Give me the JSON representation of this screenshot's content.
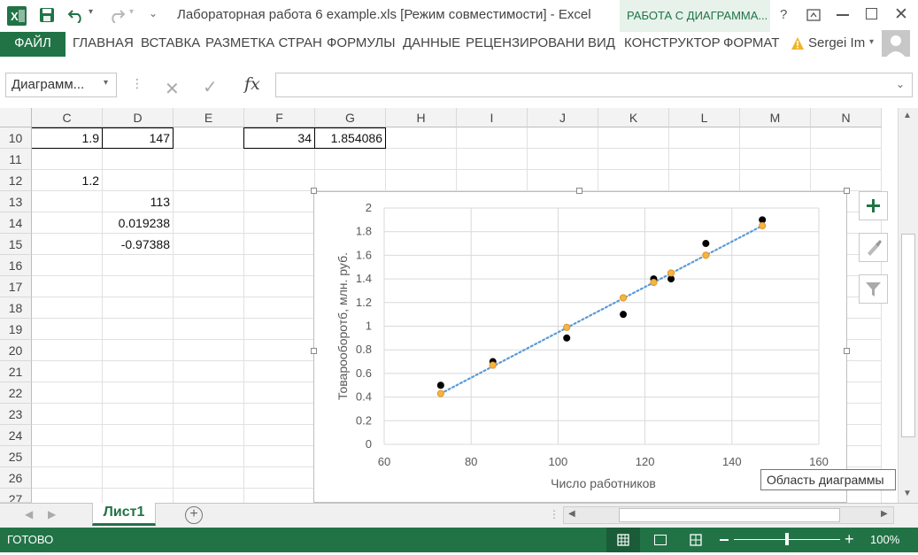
{
  "window": {
    "title": "Лабораторная работа 6 example.xls  [Режим совместимости] - Excel",
    "context_header": "РАБОТА С ДИАГРАММА...",
    "help": "?",
    "user": "Sergei Im"
  },
  "ribbon": {
    "file": "ФАЙЛ",
    "tabs": [
      "ГЛАВНАЯ",
      "ВСТАВКА",
      "РАЗМЕТКА СТРАН",
      "ФОРМУЛЫ",
      "ДАННЫЕ",
      "РЕЦЕНЗИРОВАНИ",
      "ВИД",
      "КОНСТРУКТОР",
      "ФОРМАТ"
    ]
  },
  "formula_bar": {
    "name_box": "Диаграмм...",
    "fx": "fx",
    "formula": ""
  },
  "columns": [
    "C",
    "D",
    "E",
    "F",
    "G",
    "H",
    "I",
    "J",
    "K",
    "L",
    "M",
    "N"
  ],
  "rows": [
    "10",
    "11",
    "12",
    "13",
    "14",
    "15",
    "16",
    "17",
    "18",
    "19",
    "20",
    "21",
    "22",
    "23",
    "24",
    "25",
    "26",
    "27"
  ],
  "cells": {
    "c10": "1.9",
    "d10": "147",
    "f10": "34",
    "g10": "1.854086",
    "c12": "1.2",
    "d13": "113",
    "d14": "0.019238",
    "d15": "-0.97388"
  },
  "chart_data": {
    "type": "scatter",
    "xlabel": "Число работников",
    "ylabel": "Товарооборотб, млн. руб.",
    "xlim": [
      60,
      160
    ],
    "ylim": [
      0,
      2
    ],
    "x_ticks": [
      "60",
      "80",
      "100",
      "120",
      "140",
      "160"
    ],
    "y_ticks": [
      "0",
      "0.2",
      "0.4",
      "0.6",
      "0.8",
      "1",
      "1.2",
      "1.4",
      "1.6",
      "1.8",
      "2"
    ],
    "grid": true,
    "series": [
      {
        "color": "#000000",
        "points": [
          [
            73,
            0.5
          ],
          [
            85,
            0.7
          ],
          [
            102,
            0.9
          ],
          [
            115,
            1.1
          ],
          [
            122,
            1.4
          ],
          [
            126,
            1.4
          ],
          [
            134,
            1.7
          ],
          [
            147,
            1.9
          ]
        ]
      },
      {
        "color": "#f5b53f",
        "points": [
          [
            73,
            0.43
          ],
          [
            85,
            0.67
          ],
          [
            102,
            0.99
          ],
          [
            115,
            1.24
          ],
          [
            122,
            1.37
          ],
          [
            126,
            1.45
          ],
          [
            134,
            1.6
          ],
          [
            147,
            1.85
          ]
        ]
      }
    ],
    "trendline": {
      "color": "#5b9bd5",
      "style": "dotted",
      "from": [
        73,
        0.43
      ],
      "to": [
        147,
        1.85
      ]
    }
  },
  "chart_tooltip": "Область диаграммы",
  "sheet_tabs": {
    "active": "Лист1"
  },
  "status": {
    "ready": "ГОТОВО",
    "zoom": "100%",
    "zoom_level_percent": 100
  },
  "colors": {
    "accent": "#217346",
    "context": "#e6f2ea"
  }
}
